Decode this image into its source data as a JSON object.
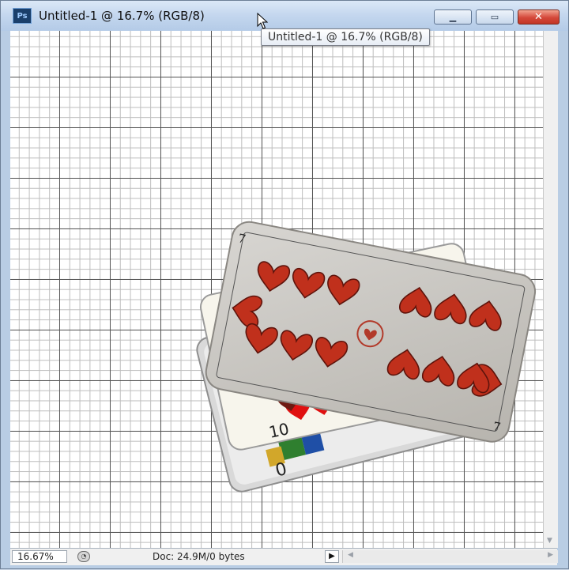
{
  "app": {
    "icon": "photoshop-icon",
    "icon_label": "Ps",
    "title": "Untitled-1 @ 16.7% (RGB/8)"
  },
  "window_controls": {
    "minimize": "minimize-icon",
    "maximize": "maximize-icon",
    "close": "close-icon"
  },
  "tooltip": {
    "text": "Untitled-1 @ 16.7% (RGB/8)"
  },
  "statusbar": {
    "zoom": "16.67%",
    "doc_info": "Doc: 24.9M/0 bytes",
    "menu_arrow": "▶"
  },
  "canvas": {
    "background": "#ffffff",
    "grid_major_color": "#555555",
    "grid_minor_color": "#bdbdbd",
    "content": "stacked playing cards image"
  },
  "cards": {
    "top_card_rank": "7",
    "middle_card_rank": "10",
    "bottom_card_rank": "0",
    "heart_color": "#c0301c",
    "heart_dark_color": "#6e1a12"
  }
}
